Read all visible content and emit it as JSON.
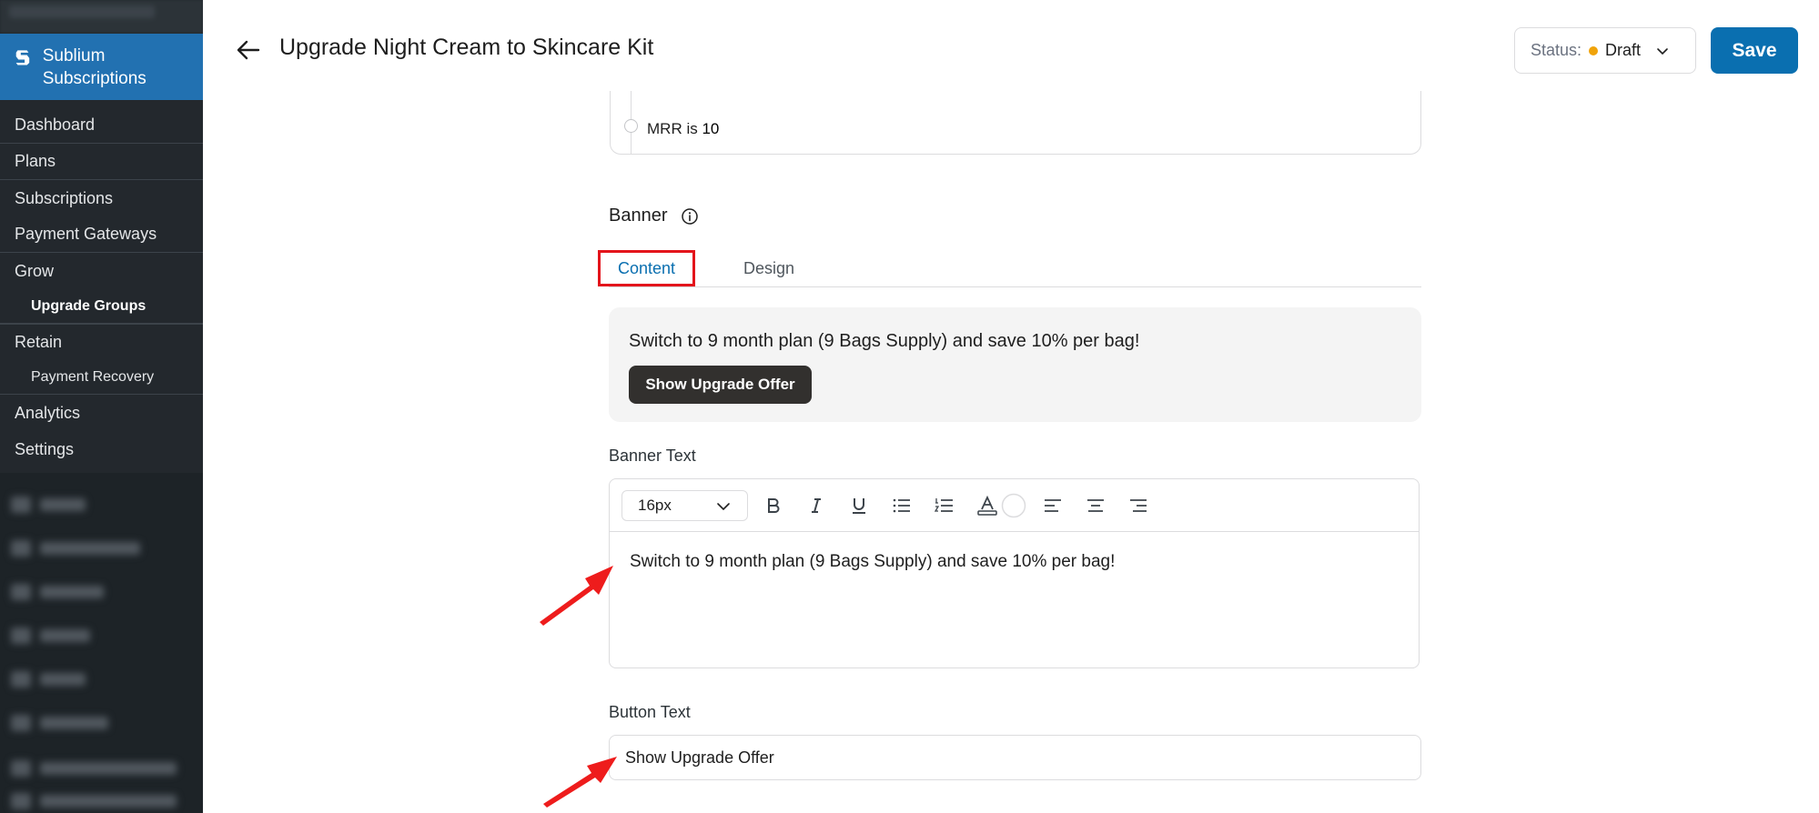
{
  "sidebar": {
    "brand": "Sublium Subscriptions",
    "items": [
      {
        "label": "Dashboard"
      },
      {
        "label": "Plans"
      },
      {
        "label": "Subscriptions"
      },
      {
        "label": "Payment Gateways"
      },
      {
        "label": "Grow"
      },
      {
        "label": "Upgrade Groups"
      },
      {
        "label": "Retain"
      },
      {
        "label": "Payment Recovery"
      },
      {
        "label": "Analytics"
      },
      {
        "label": "Settings"
      }
    ]
  },
  "header": {
    "title": "Upgrade Night Cream to Skincare Kit",
    "status_label": "Status:",
    "status_value": "Draft",
    "status_color": "#f0a30a",
    "save_label": "Save",
    "accent": "#0a6fb0"
  },
  "conditions": {
    "prefix": "MRR is",
    "value": "10"
  },
  "banner": {
    "heading": "Banner",
    "tabs": [
      {
        "label": "Content",
        "active": true
      },
      {
        "label": "Design",
        "active": false
      }
    ],
    "preview_text": "Switch to 9 month plan (9 Bags Supply) and save 10% per bag!",
    "preview_button": "Show Upgrade Offer",
    "banner_text_label": "Banner Text",
    "font_size": "16px",
    "toolbar_icons": [
      "bold-icon",
      "italic-icon",
      "underline-icon",
      "bullet-list-icon",
      "numbered-list-icon",
      "text-color-icon",
      "color-swatch",
      "align-left-icon",
      "align-center-icon",
      "align-right-icon"
    ],
    "editor_text": "Switch to 9 month plan (9 Bags Supply) and save 10% per bag!",
    "button_text_label": "Button Text",
    "button_text_value": "Show Upgrade Offer"
  }
}
